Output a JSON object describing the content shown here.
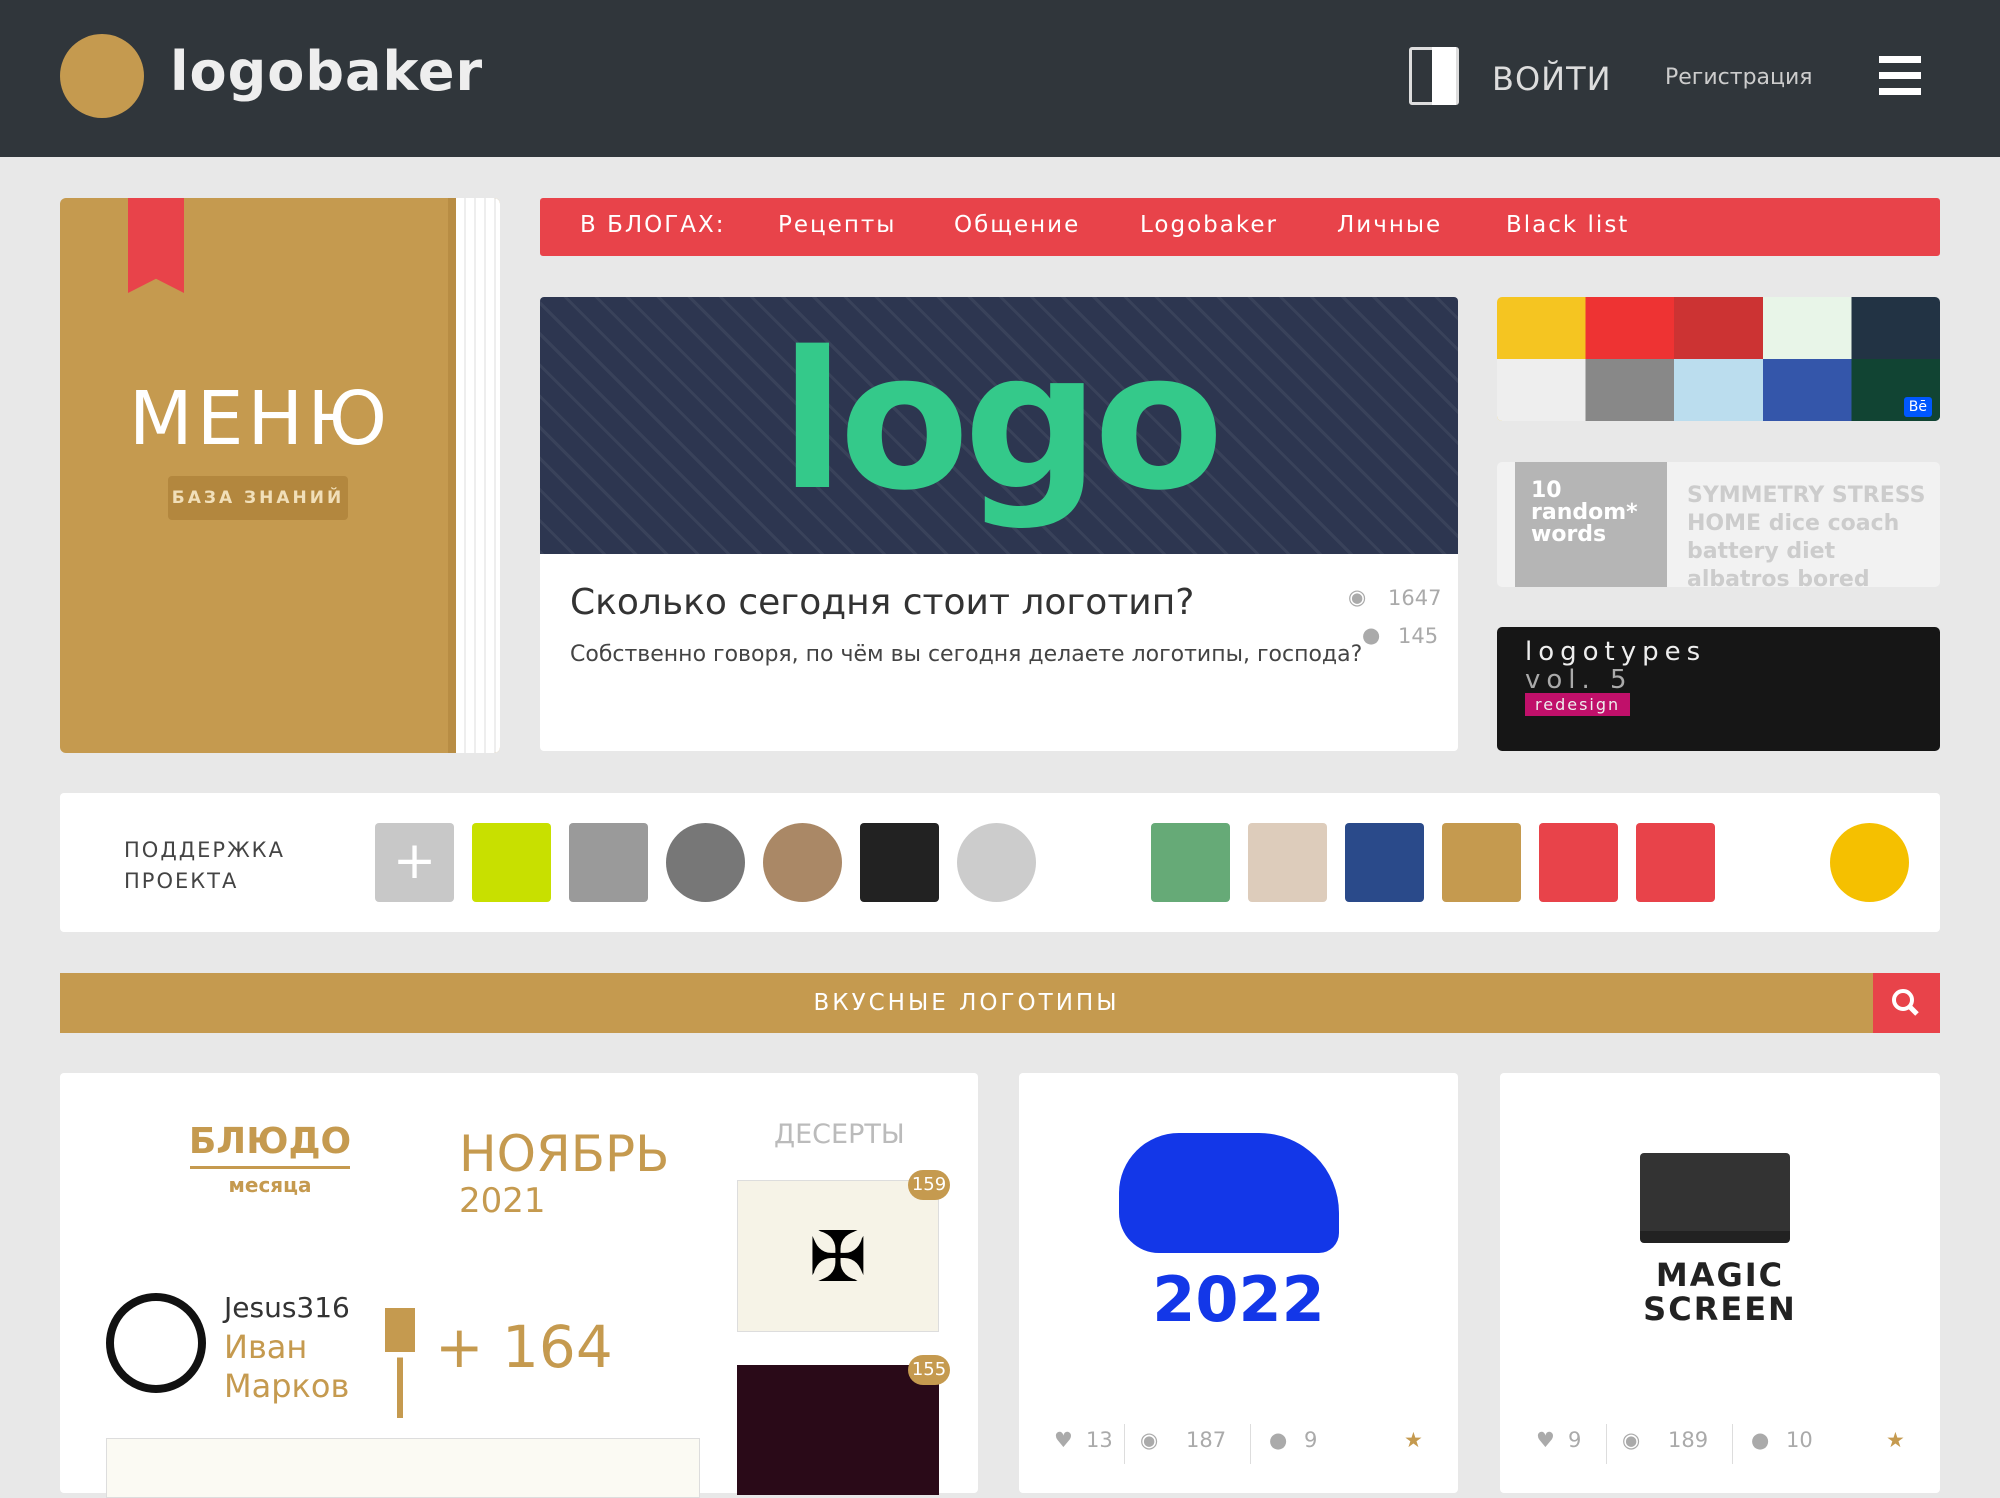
{
  "header": {
    "logo": "logobaker",
    "login": "ВОЙТИ",
    "register": "Регистрация"
  },
  "menu_book": {
    "title": "МЕНЮ",
    "subtitle": "БАЗА ЗНАНИЙ"
  },
  "blog_nav": {
    "label": "В БЛОГАХ:",
    "items": [
      "Рецепты",
      "Общение",
      "Logobaker",
      "Личные",
      "Black list"
    ]
  },
  "featured": {
    "image_text": "logo",
    "title": "Сколько сегодня стоит логотип?",
    "subtitle": "Собственно говоря, по чём вы сегодня делаете логотипы, господа?",
    "views": "1647",
    "comments": "145"
  },
  "side_thumbs": [
    {
      "badge": "Bē"
    },
    {
      "title": "10 random* words",
      "words": "SYMMETRY STRESS HOME dice coach battery diet albatros bored seek"
    },
    {
      "title": "logotypes",
      "subtitle": "vol. 5",
      "tag": "redesign"
    }
  ],
  "support": {
    "label_line1": "ПОДДЕРЖКА",
    "label_line2": "ПРОЕКТА",
    "add": "+",
    "avatar_colors": [
      "#c8e000",
      "#9a9a9a",
      "#777",
      "#a86",
      "#222",
      "#ccc",
      "#fff",
      "#6a7",
      "#dcb",
      "#2a4a8a",
      "#c59a4f",
      "#e8434a",
      "#e8434a",
      "#fff",
      "#f5c000"
    ]
  },
  "section": {
    "title": "ВКУСНЫЕ ЛОГОТИПЫ"
  },
  "dish_of_month": {
    "badge_line1": "БЛЮДО",
    "badge_line2": "месяца",
    "month": "НОЯБРЬ",
    "year": "2021",
    "category": "ДЕСЕРТЫ",
    "username": "Jesus316",
    "first_name": "Иван",
    "last_name": "Марков",
    "score": "+ 164",
    "dessert_counts": [
      "159",
      "155"
    ]
  },
  "cards": [
    {
      "logo_text": "2022",
      "likes": "13",
      "views": "187",
      "comments": "9"
    },
    {
      "logo_text": "MAGIC SCREEN",
      "likes": "9",
      "views": "189",
      "comments": "10"
    }
  ],
  "colors": {
    "gold": "#c59a4f",
    "red": "#e8434a",
    "header": "#30363b"
  }
}
